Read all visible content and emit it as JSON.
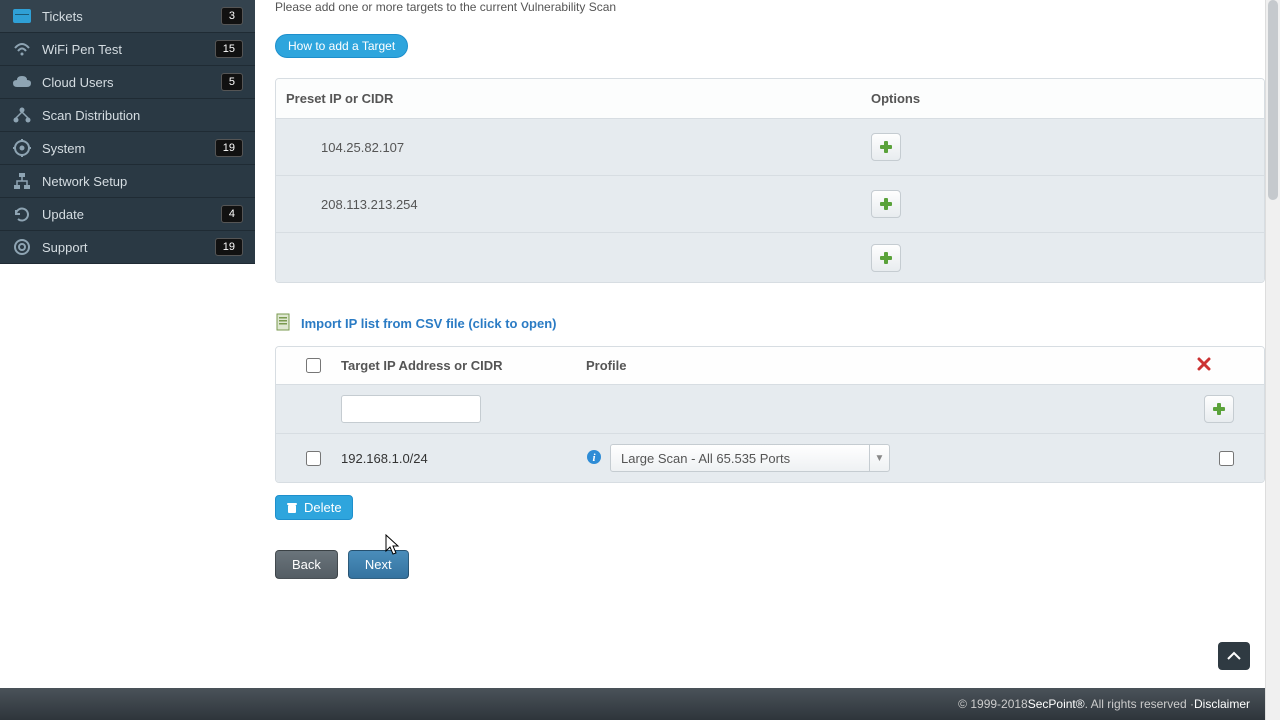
{
  "sidebar": {
    "items": [
      {
        "label": "Tickets",
        "badge": "3"
      },
      {
        "label": "WiFi Pen Test",
        "badge": "15"
      },
      {
        "label": "Cloud Users",
        "badge": "5"
      },
      {
        "label": "Scan Distribution",
        "badge": ""
      },
      {
        "label": "System",
        "badge": "19"
      },
      {
        "label": "Network Setup",
        "badge": ""
      },
      {
        "label": "Update",
        "badge": "4"
      },
      {
        "label": "Support",
        "badge": "19"
      }
    ]
  },
  "main": {
    "instruction": "Please add one or more targets to the current Vulnerability Scan",
    "how_to_label": "How to add a Target",
    "preset_table": {
      "col1": "Preset IP or CIDR",
      "col2": "Options",
      "rows": [
        {
          "ip": "104.25.82.107"
        },
        {
          "ip": "208.113.213.254"
        },
        {
          "ip": ""
        }
      ]
    },
    "import_link": "Import IP list from CSV file (click to open)",
    "targets_table": {
      "col_ip": "Target IP Address or CIDR",
      "col_profile": "Profile",
      "rows": [
        {
          "type": "input",
          "value": ""
        },
        {
          "type": "data",
          "ip": "192.168.1.0/24",
          "profile": "Large Scan - All 65.535 Ports"
        }
      ]
    },
    "delete_label": "Delete",
    "back_label": "Back",
    "next_label": "Next"
  },
  "footer": {
    "copyright": "© 1999-2018 ",
    "company": "SecPoint®",
    "rights": ". All rights reserved · ",
    "disclaimer": "Disclaimer"
  }
}
